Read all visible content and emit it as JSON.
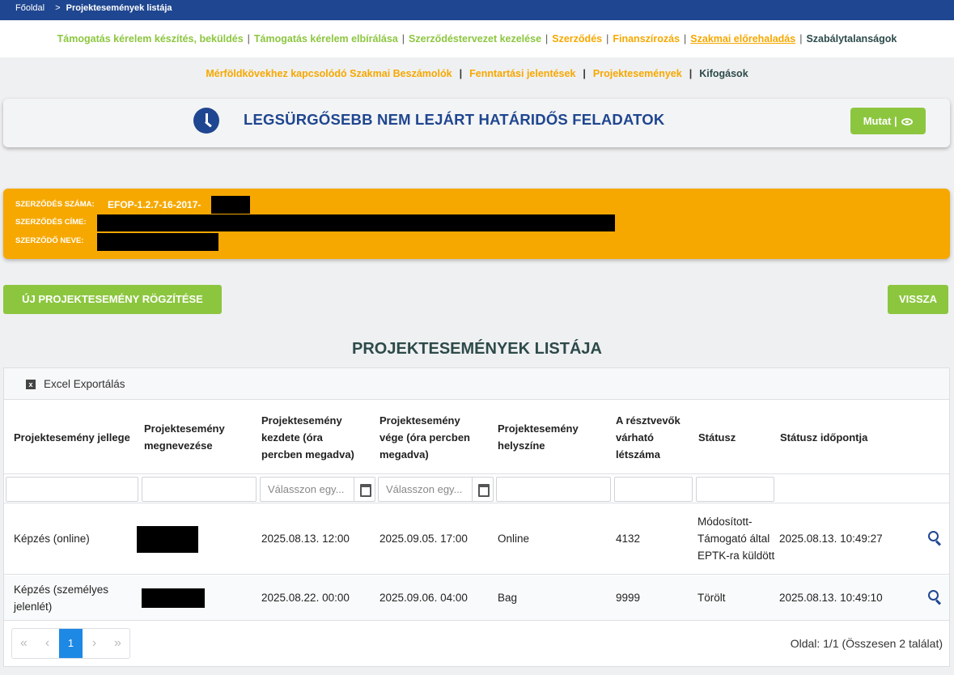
{
  "breadcrumb": {
    "home": "Főoldal",
    "separator": ">",
    "current": "Projektesemények listája"
  },
  "main_nav": [
    {
      "label": "Támogatás kérelem készítés, beküldés"
    },
    {
      "label": "Támogatás kérelem elbírálása"
    },
    {
      "label": "Szerződéstervezet kezelése"
    },
    {
      "label": "Szerződés"
    },
    {
      "label": "Finanszírozás"
    },
    {
      "label": "Szakmai előrehaladás"
    },
    {
      "label": "Szabálytalanságok"
    }
  ],
  "sub_nav": [
    {
      "label": "Mérföldkövekhez kapcsolódó Szakmai Beszámolók"
    },
    {
      "label": "Fenntartási jelentések"
    },
    {
      "label": "Projektesemények"
    },
    {
      "label": "Kifogások"
    }
  ],
  "urgent": {
    "title": "LEGSÜRGŐSEBB NEM LEJÁRT HATÁRIDŐS FELADATOK",
    "button": "Mutat |",
    "icon": "clock-icon"
  },
  "contract": {
    "number_label": "SZERZŐDÉS SZÁMA:",
    "number_value": "EFOP-1.2.7-16-2017-",
    "title_label": "SZERZŐDÉS CÍME:",
    "contractor_label": "SZERZŐDŐ NEVE:"
  },
  "buttons": {
    "new_event": "ÚJ PROJEKTESEMÉNY RÖGZÍTÉSE",
    "back": "VISSZA"
  },
  "list_title": "PROJEKTESEMÉNYEK LISTÁJA",
  "toolbar": {
    "excel_export": "Excel Exportálás"
  },
  "columns": [
    "Projektesemény jellege",
    "Projektesemény megnevezése",
    "Projektesemény kezdete (óra percben megadva)",
    "Projektesemény vége (óra percben megadva)",
    "Projektesemény helyszíne",
    "A résztvevők várható létszáma",
    "Státusz",
    "Státusz időpontja"
  ],
  "filters": {
    "date_placeholder": "Válasszon egy..."
  },
  "rows": [
    {
      "type": "Képzés (online)",
      "start": "2025.08.13. 12:00",
      "end": "2025.09.05. 17:00",
      "location": "Online",
      "participants": "4132",
      "status": "Módosított-Támogató által EPTK-ra küldött",
      "status_time": "2025.08.13. 10:49:27"
    },
    {
      "type": "Képzés (személyes jelenlét)",
      "start": "2025.08.22. 00:00",
      "end": "2025.09.06. 04:00",
      "location": "Bag",
      "participants": "9999",
      "status": "Törölt",
      "status_time": "2025.08.13. 10:49:10"
    }
  ],
  "pager": {
    "first": "«",
    "prev": "‹",
    "current": "1",
    "next": "›",
    "last": "»",
    "info": "Oldal: 1/1 (Összesen 2 találat)"
  },
  "colors": {
    "navy": "#1f4690",
    "green": "#8cc63f",
    "orange": "#f6a800",
    "active_page": "#1e88e5"
  }
}
